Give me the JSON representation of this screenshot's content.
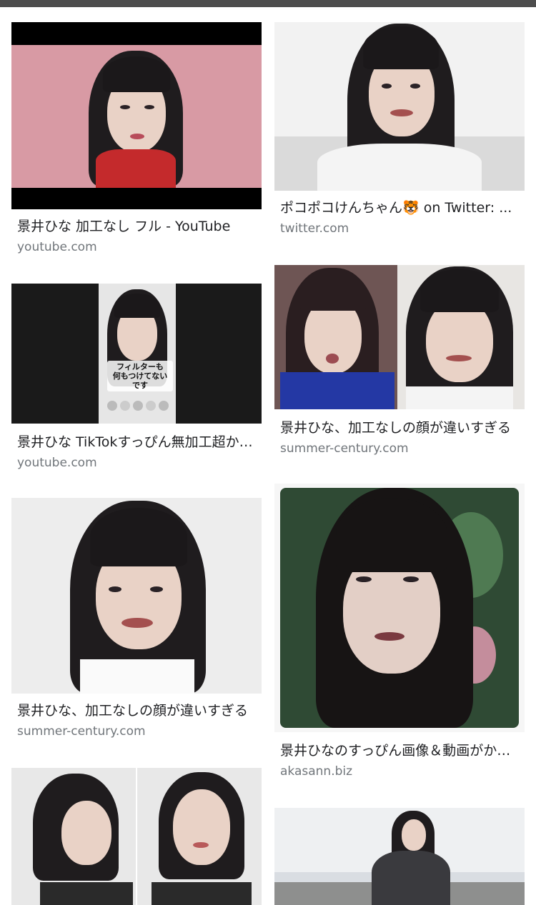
{
  "results": [
    {
      "title": "景井ひな 加工なし フル - YouTube",
      "source": "youtube.com"
    },
    {
      "title": "ポコポコけんちゃん🐯 on Twitter: ...",
      "source": "twitter.com"
    },
    {
      "title": "景井ひな TikTokすっぴん無加工超かわいい",
      "source": "youtube.com",
      "overlay": "フィルターも\n何もつけてないです"
    },
    {
      "title": "景井ひな、加工なしの顔が違いすぎる",
      "source": "summer-century.com"
    },
    {
      "title": "景井ひな、加工なしの顔が違いすぎる",
      "source": "summer-century.com"
    },
    {
      "title": "景井ひなのすっぴん画像＆動画がかわいい",
      "source": "akasann.biz"
    },
    {
      "title": "",
      "source": ""
    },
    {
      "title": "",
      "source": ""
    }
  ]
}
